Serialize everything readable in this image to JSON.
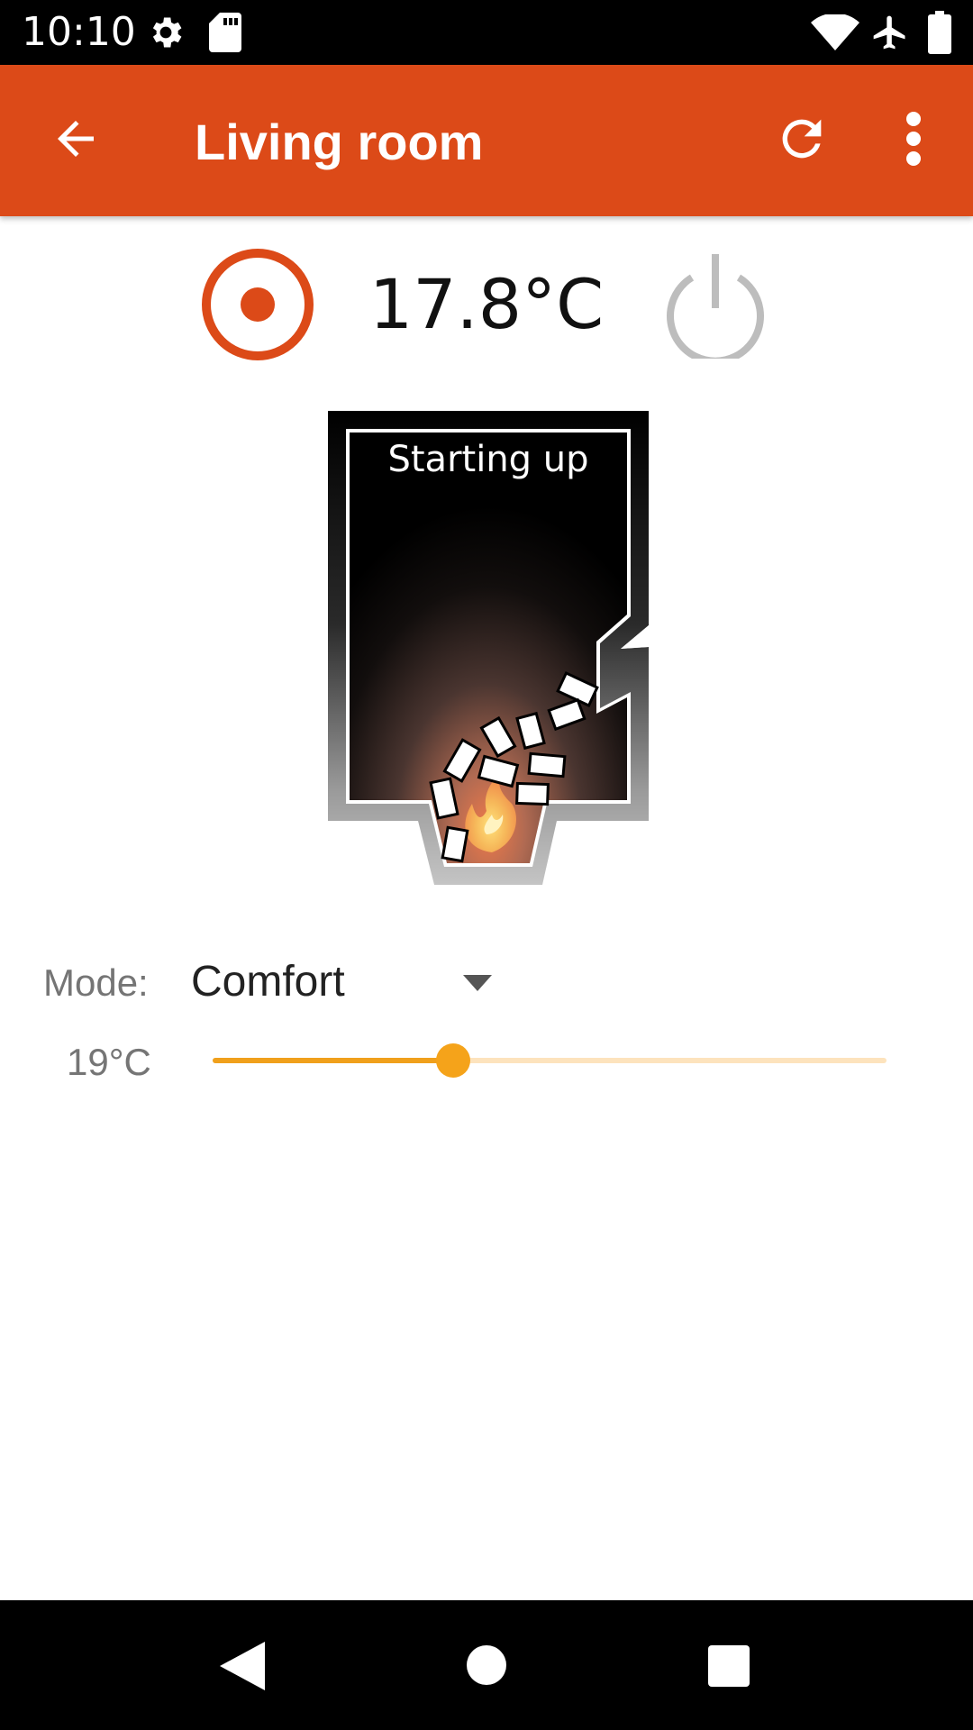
{
  "status_bar": {
    "time": "10:10",
    "left_icons": [
      "gear-icon",
      "sd-card-icon"
    ],
    "right_icons": [
      "wifi-icon",
      "airplane-icon",
      "battery-icon"
    ]
  },
  "app_bar": {
    "title": "Living room",
    "actions": [
      "back-arrow-icon",
      "refresh-icon",
      "more-vert-icon"
    ],
    "color": "#dc4a18"
  },
  "controls": {
    "current_temperature": "17.8°C",
    "target_icon": "target-icon",
    "power_icon": "power-icon",
    "accent": "#dc4a18",
    "power_color": "#bdbdbd"
  },
  "stove": {
    "status": "Starting up"
  },
  "mode": {
    "label": "Mode:",
    "value": "Comfort"
  },
  "setpoint": {
    "label": "19°C",
    "slider_fraction": 0.357,
    "accent": "#f0a01c"
  },
  "nav_bar": {
    "buttons": [
      "nav-back-icon",
      "nav-home-icon",
      "nav-recent-icon"
    ]
  }
}
